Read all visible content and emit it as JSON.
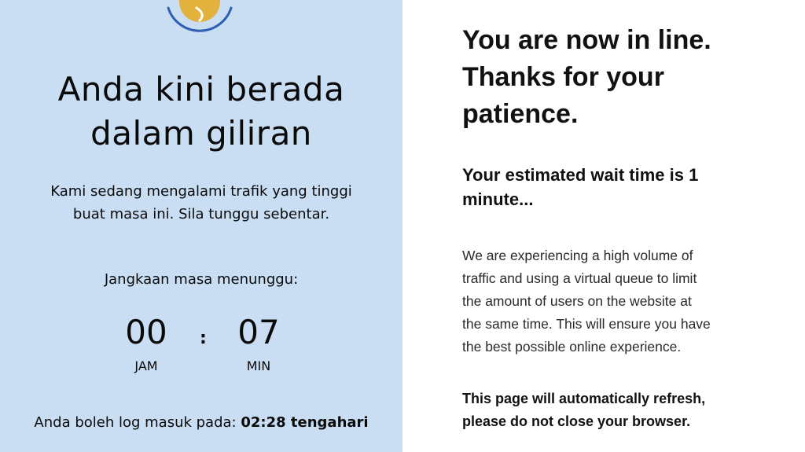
{
  "left_panel": {
    "title_line1": "Anda kini berada",
    "title_line2": "dalam giliran",
    "subtitle_line1": "Kami sedang mengalami trafik yang tinggi",
    "subtitle_line2": "buat masa ini. Sila tunggu sebentar.",
    "wait_range_label": "Jangkaan masa menunggu:",
    "timer": {
      "hours": "00",
      "hours_label": "JAM",
      "separator": ":",
      "minutes": "07",
      "minutes_label": "MIN"
    },
    "login_prefix": "Anda boleh log masuk pada:",
    "login_time": "02:28 tengahari",
    "icon": "clock-icon",
    "colors": {
      "background": "#c9ddf3",
      "clock_ring": "#2f5fb3",
      "clock_face": "#e3b23c"
    }
  },
  "right_panel": {
    "title_line1": "You are now in line.",
    "title_line2": "Thanks for your",
    "title_line3": "patience.",
    "wait_line1": "Your estimated wait time is 1",
    "wait_line2": "minute...",
    "body_lines": [
      "We are experiencing a high volume of",
      "traffic and using a virtual queue to limit",
      "the amount of users on the website at",
      "the same time. This will ensure you have",
      "the best possible online experience."
    ],
    "refresh_line1": "This page will automatically refresh,",
    "refresh_line2": "please do not close your browser."
  }
}
